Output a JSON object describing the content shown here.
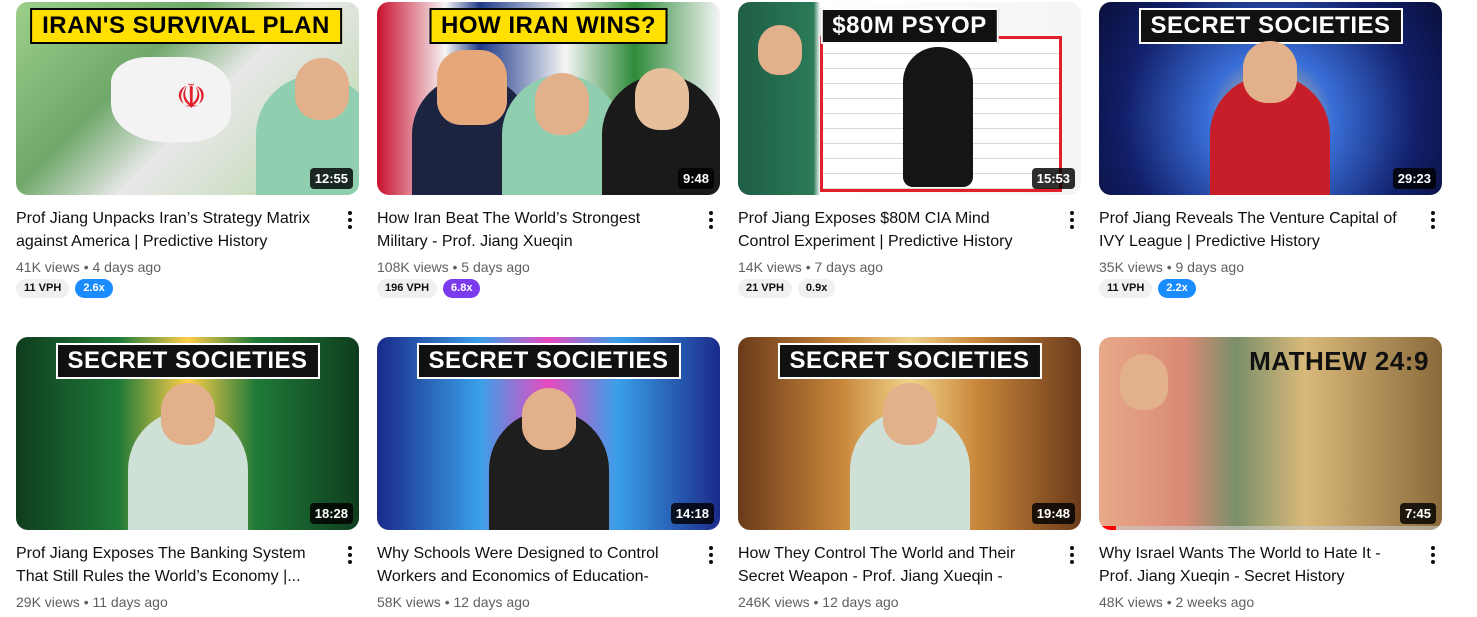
{
  "videos": [
    {
      "thumb_text": "IRAN'S SURVIVAL PLAN",
      "duration": "12:55",
      "title": "Prof Jiang Unpacks Iran’s Strategy Matrix against America | Predictive History",
      "views": "41K views",
      "age": "4 days ago",
      "vph": "11 VPH",
      "ratio": "2.6x"
    },
    {
      "thumb_text": "HOW IRAN WINS?",
      "duration": "9:48",
      "title": "How Iran Beat The World’s Strongest Military - Prof. Jiang Xueqin",
      "views": "108K views",
      "age": "5 days ago",
      "vph": "196 VPH",
      "ratio": "6.8x"
    },
    {
      "thumb_text": "$80M PSYOP",
      "duration": "15:53",
      "title": "Prof Jiang Exposes $80M CIA Mind Control Experiment | Predictive History",
      "views": "14K views",
      "age": "7 days ago",
      "vph": "21 VPH",
      "ratio": "0.9x"
    },
    {
      "thumb_text": "SECRET SOCIETIES",
      "duration": "29:23",
      "title": "Prof Jiang Reveals The Venture Capital of IVY League | Predictive History",
      "views": "35K views",
      "age": "9 days ago",
      "vph": "11 VPH",
      "ratio": "2.2x"
    },
    {
      "thumb_text": "SECRET SOCIETIES",
      "duration": "18:28",
      "title": "Prof Jiang Exposes The Banking System That Still Rules the World’s Economy |...",
      "views": "29K views",
      "age": "11 days ago"
    },
    {
      "thumb_text": "SECRET SOCIETIES",
      "duration": "14:18",
      "title": "Why Schools Were Designed to Control Workers and Economics of Education- Prof...",
      "views": "58K views",
      "age": "12 days ago"
    },
    {
      "thumb_text": "SECRET SOCIETIES",
      "duration": "19:48",
      "title": "How They Control The World and Their Secret Weapon - Prof. Jiang Xueqin - Secre...",
      "views": "246K views",
      "age": "12 days ago"
    },
    {
      "thumb_text": "MATHEW 24:9",
      "duration": "7:45",
      "title": "Why Israel Wants The World to Hate It - Prof. Jiang Xueqin - Secret History",
      "views": "48K views",
      "age": "2 weeks ago",
      "watched_fraction": 0.05
    }
  ],
  "separator": "•",
  "colors": {
    "ratio_blue": "#1a8cff",
    "ratio_purple": "#7c3aed",
    "ratio_grey": "#f0f0f0",
    "progress_red": "#ff0000"
  }
}
